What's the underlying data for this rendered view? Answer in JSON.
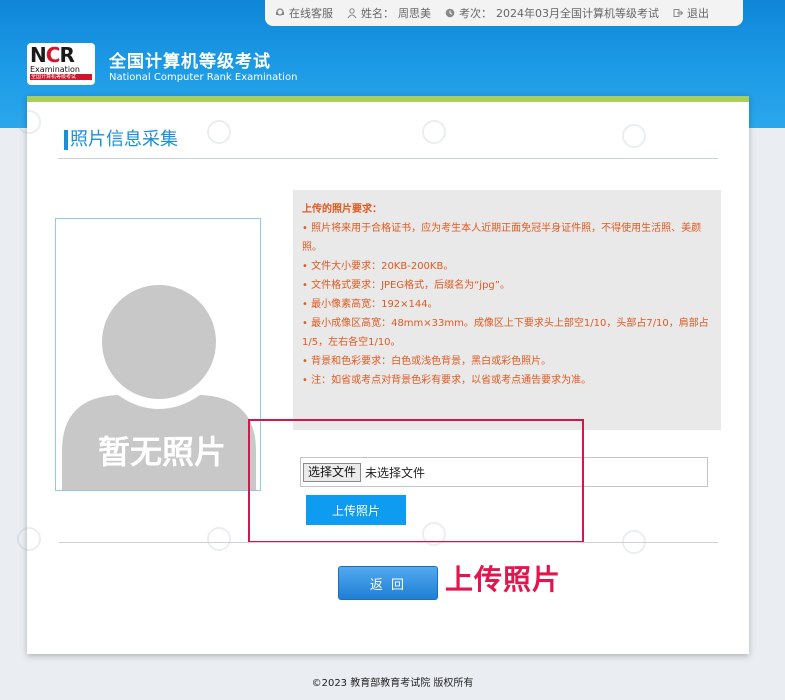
{
  "topbar": {
    "online_service": "在线客服",
    "name_label": "姓名：",
    "name_value": "周思美",
    "exam_label": "考次：",
    "exam_value": "2024年03月全国计算机等级考试",
    "logout": "退出"
  },
  "header": {
    "logo_mark_left": "N",
    "logo_mark_red": "C",
    "logo_mark_right": "R",
    "logo_sub": "Examination",
    "logo_sub2": "全国计算机等级考试",
    "title": "全国计算机等级考试",
    "subtitle": "National Computer Rank Examination"
  },
  "section": {
    "title": "照片信息采集"
  },
  "photo": {
    "placeholder_text": "暂无照片"
  },
  "requirements": {
    "title": "上传的照片要求：",
    "items": [
      "• 照片将来用于合格证书，应为考生本人近期正面免冠半身证件照，不得使用生活照、美颜照。",
      "• 文件大小要求：20KB-200KB。",
      "• 文件格式要求：JPEG格式，后缀名为“jpg”。",
      "• 最小像素高宽：192×144。",
      "• 最小成像区高宽：48mm×33mm。成像区上下要求头上部空1/10，头部占7/10，肩部占1/5，左右各空1/10。",
      "• 背景和色彩要求：白色或浅色背景，黑白或彩色照片。",
      "• 注：如省或考点对背景色彩有要求，以省或考点通告要求为准。"
    ]
  },
  "upload": {
    "file_button": "选择文件",
    "file_status": "未选择文件",
    "upload_button": "上传照片",
    "caption": "上传照片"
  },
  "actions": {
    "back_button": "返 回"
  },
  "footer": {
    "copyright": "©2023  教育部教育考试院  版权所有"
  },
  "colors": {
    "header_blue": "#1d9be6",
    "accent_green": "#a9cf5f",
    "title_blue": "#1b90d8",
    "requirement_orange": "#e05a22",
    "highlight_red": "#d3174d",
    "upload_button": "#0e9cf0"
  }
}
